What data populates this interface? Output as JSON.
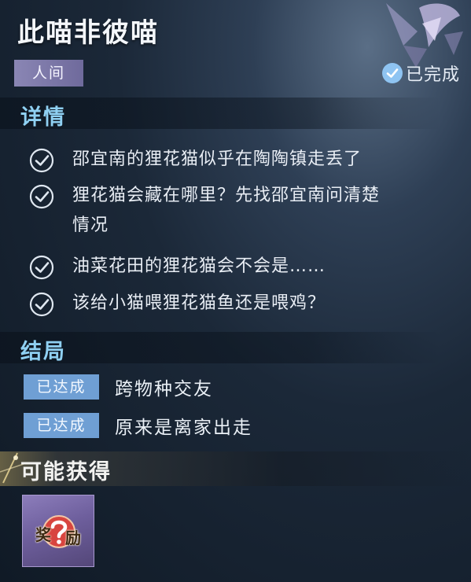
{
  "quest": {
    "title": "此喵非彼喵",
    "tag": "人间",
    "status": "已完成"
  },
  "details": {
    "heading": "详情",
    "items": [
      "邵宜南的狸花猫似乎在陶陶镇走丢了",
      "狸花猫会藏在哪里？先找邵宜南问清楚",
      "情况",
      "油菜花田的狸花猫会不会是……",
      "该给小猫喂狸花猫鱼还是喂鸡？"
    ]
  },
  "endings": {
    "heading": "结局",
    "items": [
      {
        "badge": "已达成",
        "text": "跨物种交友"
      },
      {
        "badge": "已达成",
        "text": "原来是离家出走"
      }
    ]
  },
  "rewards": {
    "heading": "可能获得",
    "item_chars": [
      "奖",
      "励"
    ],
    "item_icon": "question-mark-icon"
  },
  "colors": {
    "accent_blue": "#8fd0f2",
    "tag_purple": "#7c77a8",
    "badge_blue": "#6f9fd4",
    "reward_purple": "#6e5f9d"
  }
}
